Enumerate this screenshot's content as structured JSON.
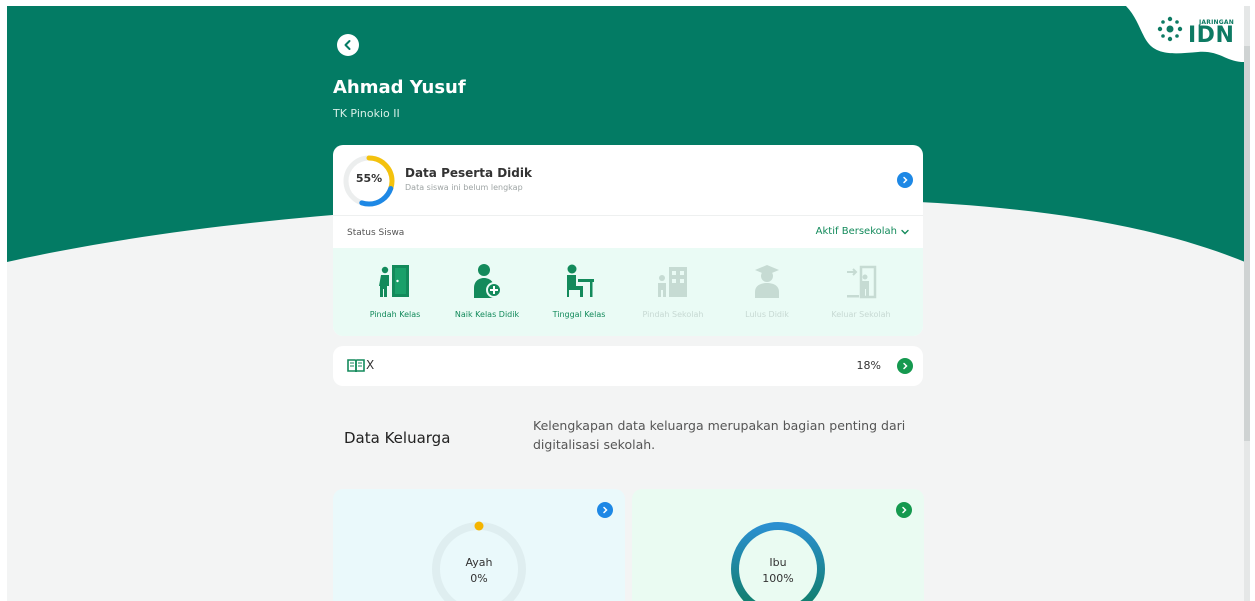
{
  "brand": {
    "logo_small": "JARINGAN",
    "logo_big": "IDN"
  },
  "student": {
    "name": "Ahmad Yusuf",
    "school": "TK Pinokio II"
  },
  "data_peserta": {
    "percent_label": "55%",
    "percent_value": 55,
    "title": "Data Peserta Didik",
    "subtitle": "Data siswa ini belum lengkap"
  },
  "status": {
    "label": "Status Siswa",
    "value": "Aktif Bersekolah"
  },
  "actions": [
    {
      "label": "Pindah Kelas",
      "icon": "move-class-icon",
      "enabled": true
    },
    {
      "label": "Naik Kelas Didik",
      "icon": "promote-student-icon",
      "enabled": true
    },
    {
      "label": "Tinggal Kelas",
      "icon": "stay-class-icon",
      "enabled": true
    },
    {
      "label": "Pindah Sekolah",
      "icon": "move-school-icon",
      "enabled": false
    },
    {
      "label": "Lulus Didik",
      "icon": "graduate-icon",
      "enabled": false
    },
    {
      "label": "Keluar Sekolah",
      "icon": "exit-school-icon",
      "enabled": false
    }
  ],
  "class_row": {
    "label": "X",
    "percent": "18%"
  },
  "keluarga": {
    "title": "Data Keluarga",
    "description": "Kelengkapan data keluarga merupakan bagian penting dari digitalisasi sekolah."
  },
  "family_cards": [
    {
      "name": "Ayah",
      "percent_label": "0%",
      "percent_value": 0
    },
    {
      "name": "Ibu",
      "percent_label": "100%",
      "percent_value": 100
    }
  ],
  "colors": {
    "brand_green": "#037b64",
    "progress_yellow": "#f4c20d",
    "progress_blue": "#1e88e5",
    "action_green": "#138a5b"
  }
}
